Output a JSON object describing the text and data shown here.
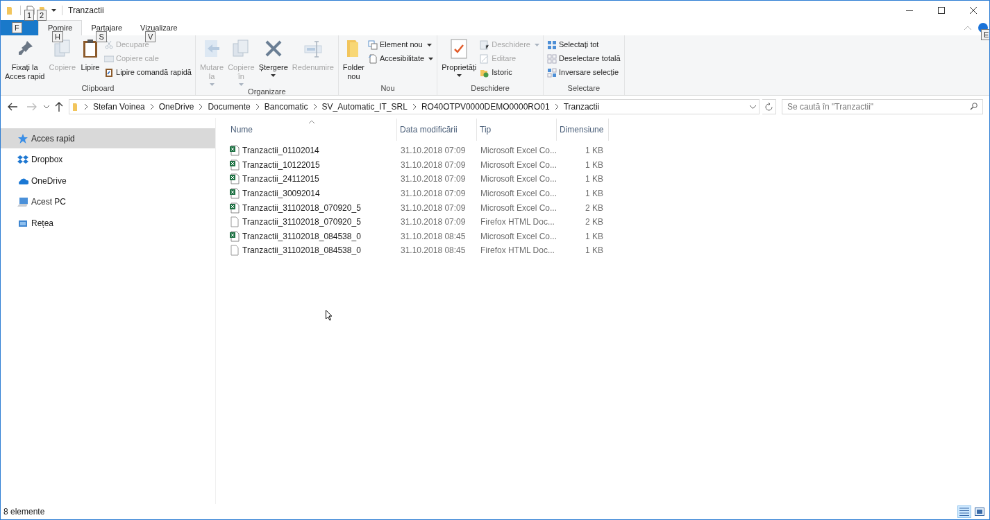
{
  "window": {
    "title": "Tranzactii"
  },
  "quick_access": [
    {
      "kind": "doc",
      "keytip": "1"
    },
    {
      "kind": "folder",
      "keytip": "2"
    }
  ],
  "file_tab": {
    "keytip": "F"
  },
  "tabs": [
    {
      "label": "Pornire",
      "selected": true,
      "keytip": "H"
    },
    {
      "label": "Partajare",
      "selected": false,
      "keytip": "S"
    },
    {
      "label": "Vizualizare",
      "selected": false,
      "keytip": "V"
    }
  ],
  "help": {
    "keytip": "E"
  },
  "ribbon": [
    {
      "label": "Clipboard",
      "items": [
        {
          "kind": "large",
          "lines": [
            "Fixați la",
            "Acces rapid"
          ],
          "disabled": false,
          "dropdown": false
        },
        {
          "kind": "large",
          "lines": [
            "Copiere"
          ],
          "disabled": true,
          "dropdown": false
        },
        {
          "kind": "large",
          "lines": [
            "Lipire"
          ],
          "disabled": false,
          "dropdown": false
        },
        {
          "kind": "stack",
          "items": [
            {
              "label": "Decupare",
              "disabled": true,
              "dropdown": false
            },
            {
              "label": "Copiere cale",
              "disabled": true,
              "dropdown": false
            },
            {
              "label": "Lipire comandă rapidă",
              "disabled": false,
              "dropdown": false
            }
          ]
        }
      ]
    },
    {
      "label": "Organizare",
      "items": [
        {
          "kind": "large",
          "lines": [
            "Mutare",
            "la"
          ],
          "disabled": true,
          "dropdown": true
        },
        {
          "kind": "large",
          "lines": [
            "Copiere",
            "în"
          ],
          "disabled": true,
          "dropdown": true
        },
        {
          "kind": "large",
          "lines": [
            "Ștergere"
          ],
          "disabled": false,
          "dropdown": true
        },
        {
          "kind": "large",
          "lines": [
            "Redenumire"
          ],
          "disabled": true,
          "dropdown": false
        }
      ]
    },
    {
      "label": "Nou",
      "items": [
        {
          "kind": "large",
          "lines": [
            "Folder",
            "nou"
          ],
          "disabled": false,
          "dropdown": false
        },
        {
          "kind": "stack",
          "items": [
            {
              "label": "Element nou",
              "disabled": false,
              "dropdown": true
            },
            {
              "label": "Accesibilitate",
              "disabled": false,
              "dropdown": true
            }
          ]
        }
      ]
    },
    {
      "label": "Deschidere",
      "items": [
        {
          "kind": "large",
          "lines": [
            "Proprietăți"
          ],
          "disabled": false,
          "dropdown": true
        },
        {
          "kind": "stack",
          "items": [
            {
              "label": "Deschidere",
              "disabled": true,
              "dropdown": true
            },
            {
              "label": "Editare",
              "disabled": true,
              "dropdown": false
            },
            {
              "label": "Istoric",
              "disabled": false,
              "dropdown": false
            }
          ]
        }
      ]
    },
    {
      "label": "Selectare",
      "items": [
        {
          "kind": "stack",
          "items": [
            {
              "label": "Selectați tot",
              "disabled": false,
              "dropdown": false
            },
            {
              "label": "Deselectare totală",
              "disabled": false,
              "dropdown": false
            },
            {
              "label": "Inversare selecție",
              "disabled": false,
              "dropdown": false
            }
          ]
        }
      ]
    }
  ],
  "breadcrumb": [
    "Stefan Voinea",
    "OneDrive",
    "Documente",
    "Bancomatic",
    "SV_Automatic_IT_SRL",
    "RO40OTPV0000DEMO0000RO01",
    "Tranzactii"
  ],
  "search": {
    "placeholder": "Se caută în \"Tranzactii\""
  },
  "sidebar": {
    "items": [
      {
        "label": "Acces rapid",
        "selected": true
      },
      {
        "label": "Dropbox",
        "selected": false
      },
      {
        "label": "OneDrive",
        "selected": false
      },
      {
        "label": "Acest PC",
        "selected": false
      },
      {
        "label": "Rețea",
        "selected": false
      }
    ]
  },
  "table": {
    "columns": [
      "Nume",
      "Data modificării",
      "Tip",
      "Dimensiune"
    ],
    "rows": [
      {
        "kind": "excel",
        "cells": [
          "Tranzactii_01102014",
          "31.10.2018 07:09",
          "Microsoft Excel Co...",
          "1 KB"
        ]
      },
      {
        "kind": "excel",
        "cells": [
          "Tranzactii_10122015",
          "31.10.2018 07:09",
          "Microsoft Excel Co...",
          "1 KB"
        ]
      },
      {
        "kind": "excel",
        "cells": [
          "Tranzactii_24112015",
          "31.10.2018 07:09",
          "Microsoft Excel Co...",
          "1 KB"
        ]
      },
      {
        "kind": "excel",
        "cells": [
          "Tranzactii_30092014",
          "31.10.2018 07:09",
          "Microsoft Excel Co...",
          "1 KB"
        ]
      },
      {
        "kind": "excel",
        "cells": [
          "Tranzactii_31102018_070920_5",
          "31.10.2018 07:09",
          "Microsoft Excel Co...",
          "2 KB"
        ]
      },
      {
        "kind": "html",
        "cells": [
          "Tranzactii_31102018_070920_5",
          "31.10.2018 07:09",
          "Firefox HTML Doc...",
          "2 KB"
        ]
      },
      {
        "kind": "excel",
        "cells": [
          "Tranzactii_31102018_084538_0",
          "31.10.2018 08:45",
          "Microsoft Excel Co...",
          "1 KB"
        ]
      },
      {
        "kind": "html",
        "cells": [
          "Tranzactii_31102018_084538_0",
          "31.10.2018 08:45",
          "Firefox HTML Doc...",
          "1 KB"
        ]
      }
    ]
  },
  "status_bar": {
    "count": "8 elemente",
    "views": [
      {
        "kind": "details",
        "selected": true
      },
      {
        "kind": "tiles",
        "selected": false
      }
    ]
  }
}
